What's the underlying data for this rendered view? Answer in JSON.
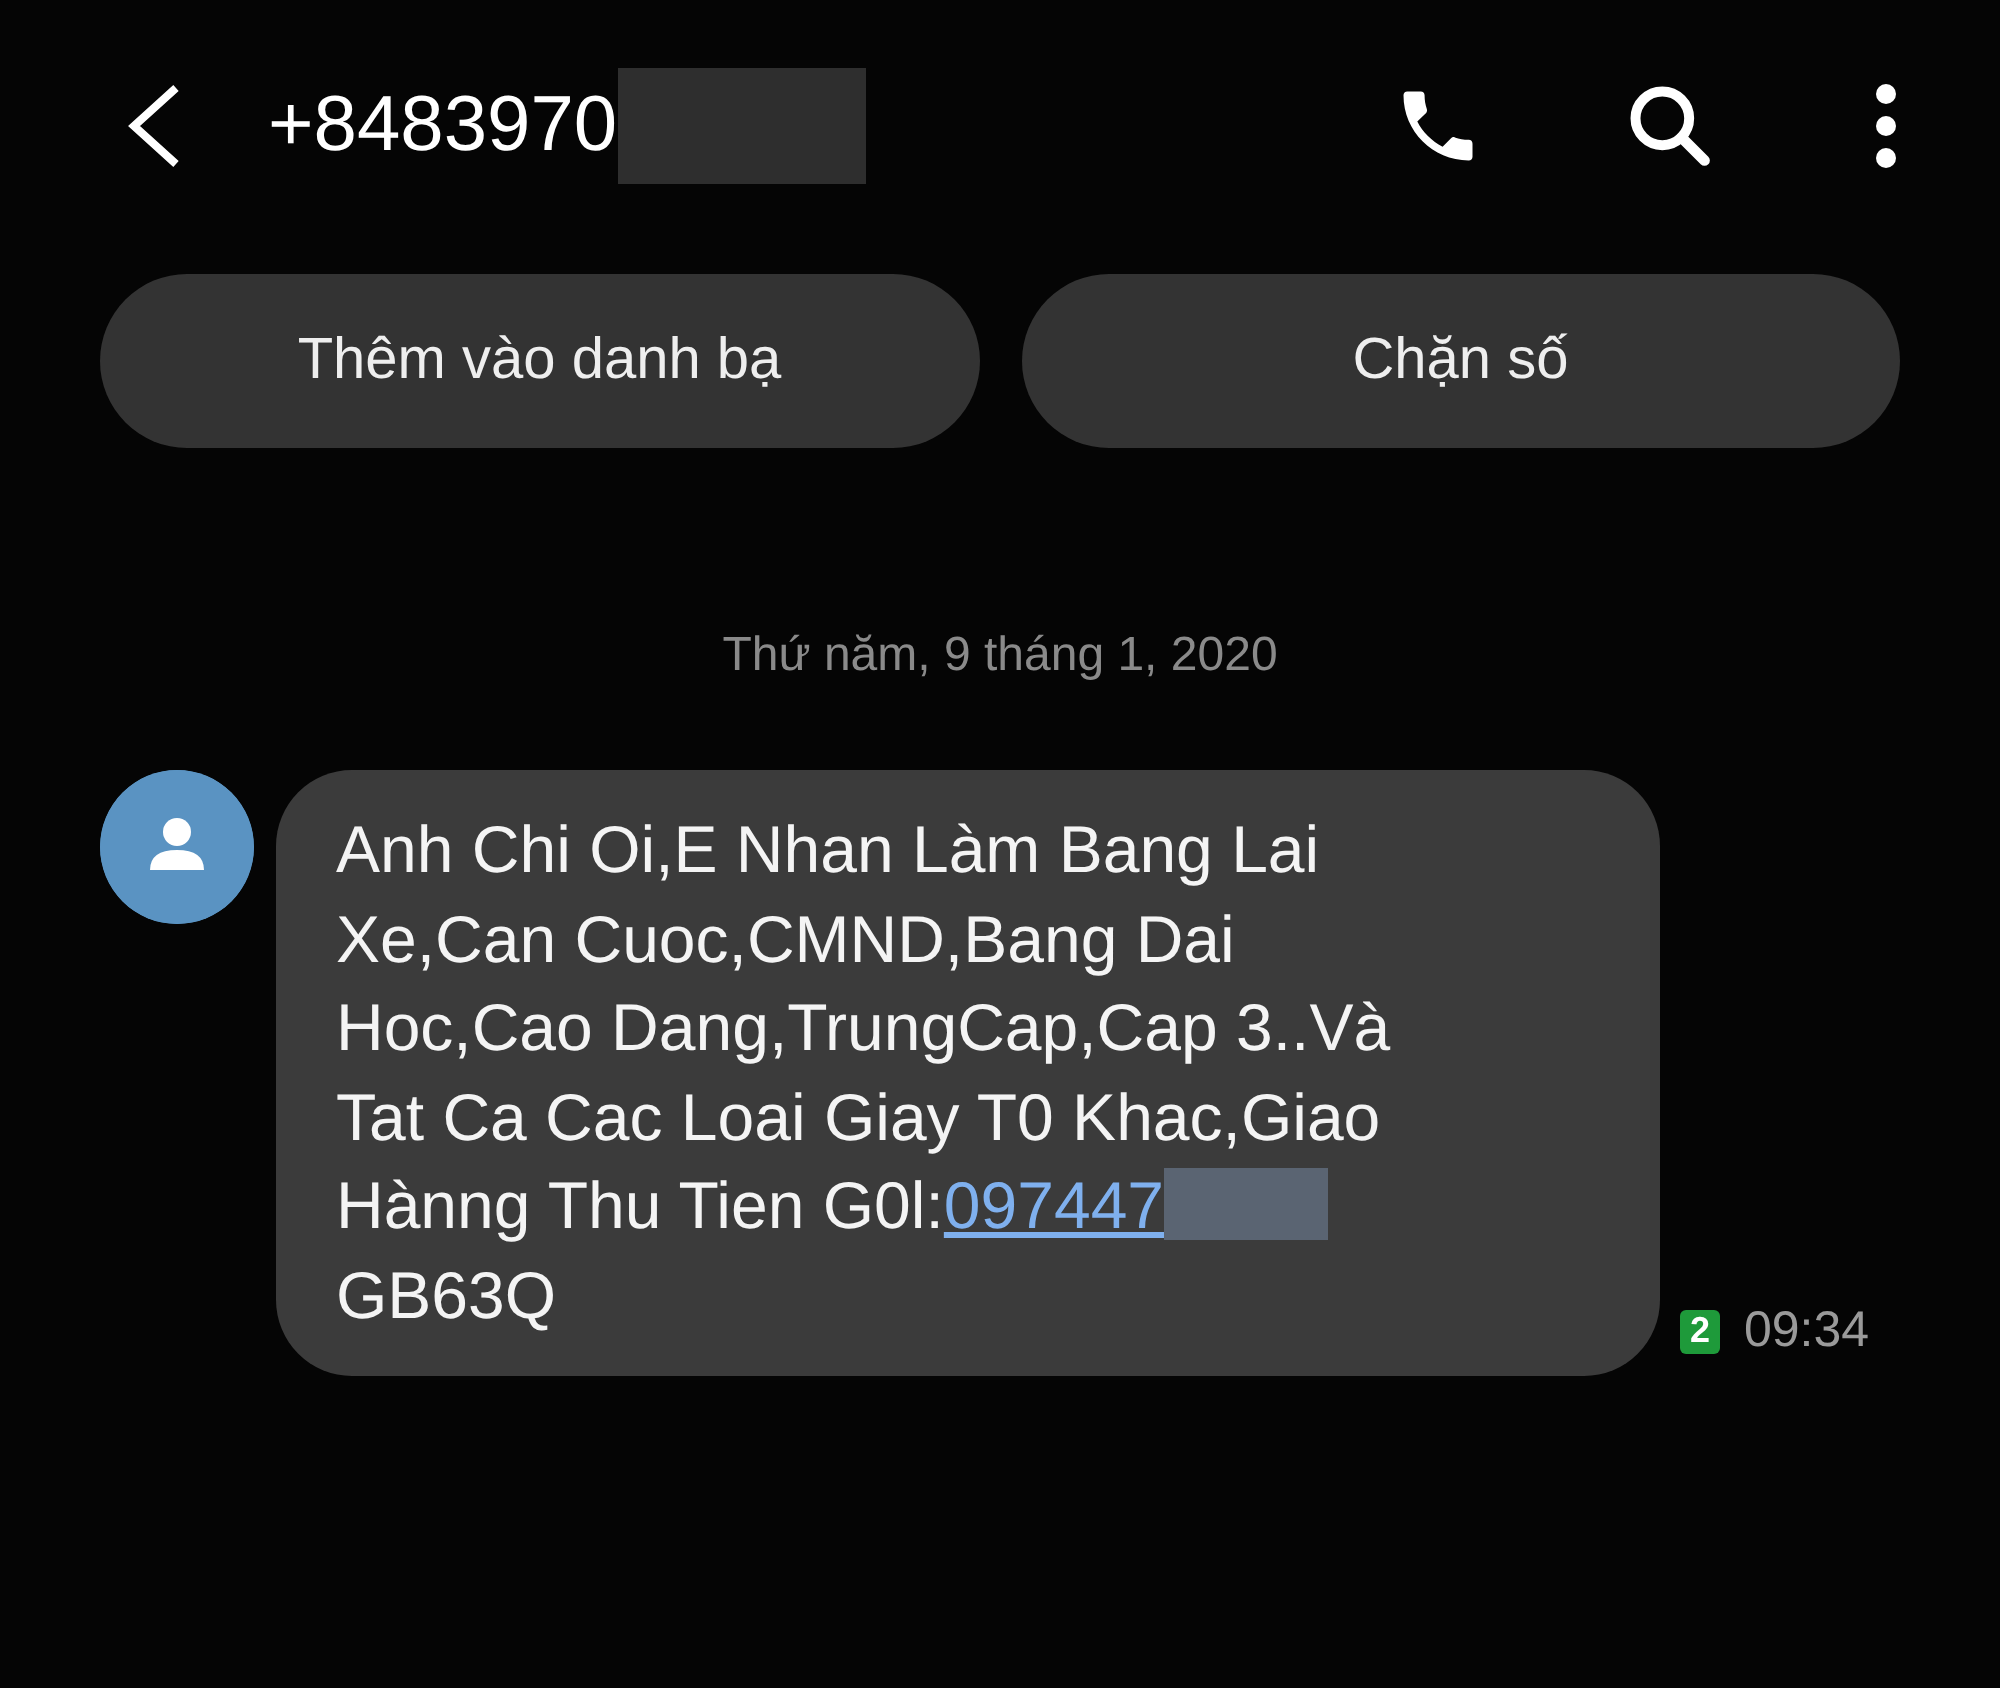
{
  "header": {
    "title": "+8483970"
  },
  "actions": [
    "Thêm vào danh bạ",
    "Chặn số"
  ],
  "date": "Thứ năm, 9 tháng 1, 2020",
  "message": {
    "lines": [
      "Anh Chi Oi,E Nhan Làm Bang Lai",
      "Xe,Can Cuoc,CMND,Bang Dai",
      "Hoc,Cao Dang,TrungCap,Cap 3..Và",
      "Tat Ca Cac Loai Giay T0 Khac,Giao",
      "Hànng Thu Tien G0l:"
    ],
    "link": "097447",
    "suffix": " GB63Q",
    "sim": "2",
    "time": "09:34"
  }
}
